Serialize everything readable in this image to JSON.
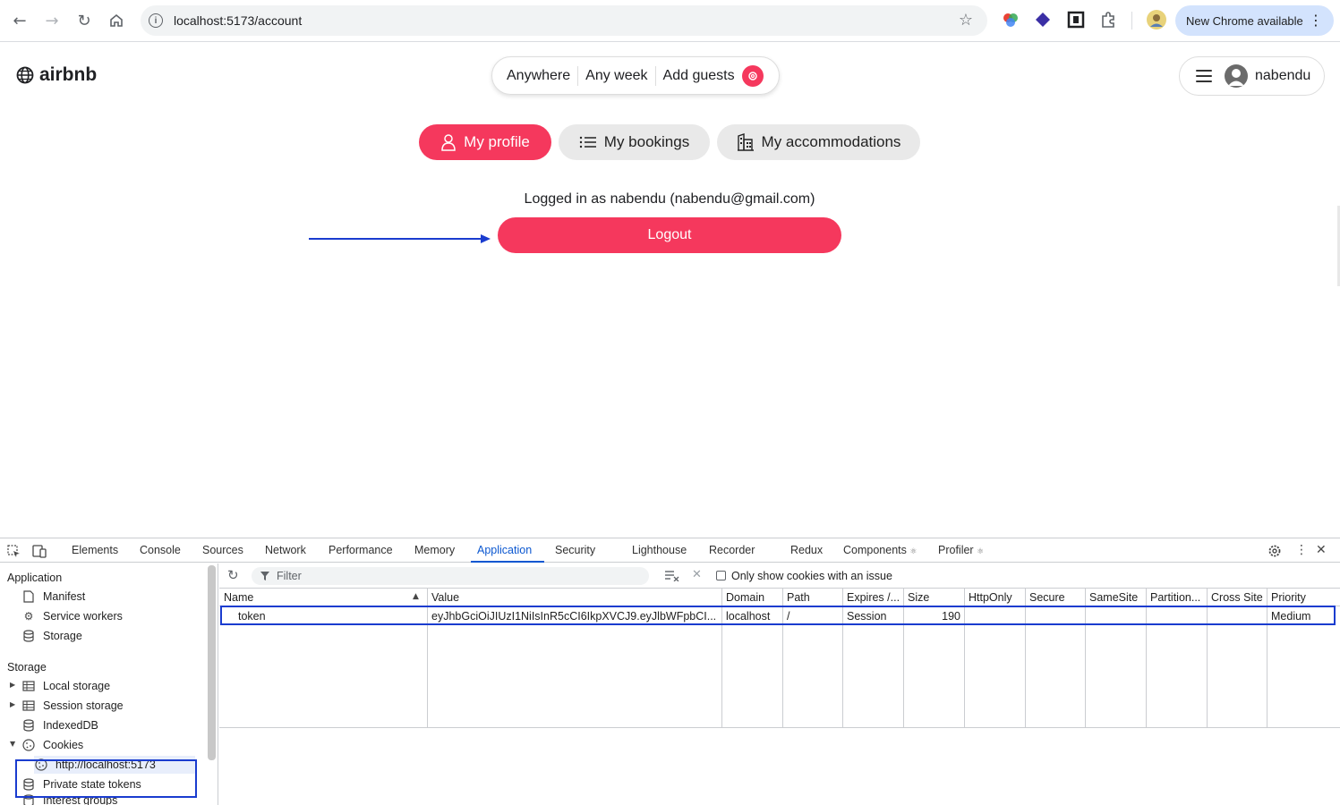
{
  "browser": {
    "url": "localhost:5173/account",
    "new_chrome_label": "New Chrome available"
  },
  "header": {
    "logo_text": "airbnb",
    "search": {
      "anywhere": "Anywhere",
      "any_week": "Any week",
      "add_guests": "Add guests"
    },
    "user_name": "nabendu"
  },
  "account_tabs": [
    {
      "label": "My profile",
      "icon": "user-icon"
    },
    {
      "label": "My bookings",
      "icon": "list-icon"
    },
    {
      "label": "My accommodations",
      "icon": "building-icon"
    }
  ],
  "profile": {
    "logged_in_text": "Logged in as nabendu (nabendu@gmail.com)",
    "logout_label": "Logout"
  },
  "devtools": {
    "tabs": [
      "Elements",
      "Console",
      "Sources",
      "Network",
      "Performance",
      "Memory",
      "Application",
      "Security",
      "Lighthouse",
      "Recorder",
      "Redux",
      "Components",
      "Profiler"
    ],
    "active_tab": "Application",
    "sidebar": {
      "application_header": "Application",
      "application_items": [
        "Manifest",
        "Service workers",
        "Storage"
      ],
      "storage_header": "Storage",
      "storage_items": [
        "Local storage",
        "Session storage",
        "IndexedDB",
        "Cookies",
        "http://localhost:5173",
        "Private state tokens",
        "Interest groups"
      ]
    },
    "toolbar": {
      "filter_placeholder": "Filter",
      "only_issue_label": "Only show cookies with an issue"
    },
    "cookie_table": {
      "columns": [
        "Name",
        "Value",
        "Domain",
        "Path",
        "Expires /...",
        "Size",
        "HttpOnly",
        "Secure",
        "SameSite",
        "Partition...",
        "Cross Site",
        "Priority"
      ],
      "rows": [
        {
          "name": "token",
          "value": "eyJhbGciOiJIUzI1NiIsInR5cCI6IkpXVCJ9.eyJlbWFpbCI...",
          "domain": "localhost",
          "path": "/",
          "expires": "Session",
          "size": "190",
          "httponly": "",
          "secure": "",
          "samesite": "",
          "partition": "",
          "cross_site": "",
          "priority": "Medium"
        }
      ]
    }
  },
  "colors": {
    "brand": "#f5385d",
    "devtools_accent": "#0b57d0",
    "annotation": "#1a3ccf"
  }
}
